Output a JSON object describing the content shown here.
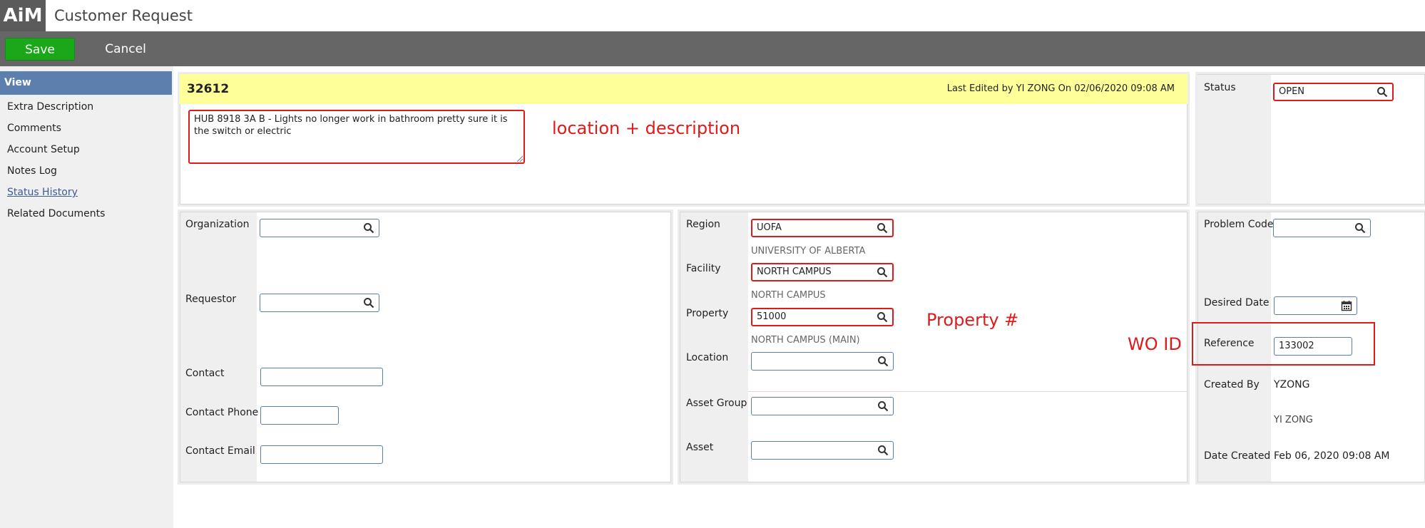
{
  "app": {
    "logo": "AiM",
    "title": "Customer Request"
  },
  "toolbar": {
    "save_label": "Save",
    "cancel_label": "Cancel"
  },
  "sidebar": {
    "header": "View",
    "items": [
      {
        "label": "Extra Description"
      },
      {
        "label": "Comments"
      },
      {
        "label": "Account Setup"
      },
      {
        "label": "Notes Log"
      },
      {
        "label": "Status History"
      },
      {
        "label": "Related Documents"
      }
    ]
  },
  "request": {
    "id": "32612",
    "last_edited": "Last Edited by YI ZONG On 02/06/2020 09:08 AM",
    "description": "HUB 8918 3A B - Lights no longer work in bathroom pretty sure it is the switch or electric"
  },
  "status": {
    "label": "Status",
    "value": "OPEN"
  },
  "left_panel": {
    "organization_label": "Organization",
    "organization_value": "",
    "requestor_label": "Requestor",
    "requestor_value": "",
    "contact_label": "Contact",
    "contact_value": "",
    "contact_phone_label": "Contact Phone",
    "contact_phone_value": "",
    "contact_email_label": "Contact Email",
    "contact_email_value": ""
  },
  "middle_panel": {
    "region_label": "Region",
    "region_value": "UOFA",
    "region_desc": "UNIVERSITY OF ALBERTA",
    "facility_label": "Facility",
    "facility_value": "NORTH CAMPUS",
    "facility_desc": "NORTH CAMPUS",
    "property_label": "Property",
    "property_value": "51000",
    "property_desc": "NORTH CAMPUS (MAIN)",
    "location_label": "Location",
    "location_value": "",
    "asset_group_label": "Asset Group",
    "asset_group_value": "",
    "asset_label": "Asset",
    "asset_value": ""
  },
  "right_panel": {
    "problem_code_label": "Problem Code",
    "problem_code_value": "",
    "desired_date_label": "Desired Date",
    "desired_date_value": "",
    "reference_label": "Reference",
    "reference_value": "133002",
    "created_by_label": "Created By",
    "created_by_value": "YZONG",
    "created_by_name": "YI ZONG",
    "date_created_label": "Date Created",
    "date_created_value": "Feb 06, 2020 09:08 AM"
  },
  "annotations": {
    "location_description": "location + description",
    "property_number": "Property #",
    "wo_id": "WO ID"
  },
  "colors": {
    "accent_red": "#e01a1a",
    "save_green": "#1aa81a",
    "sidebar_active": "#5d7fae",
    "header_yellow": "#ffff99"
  }
}
